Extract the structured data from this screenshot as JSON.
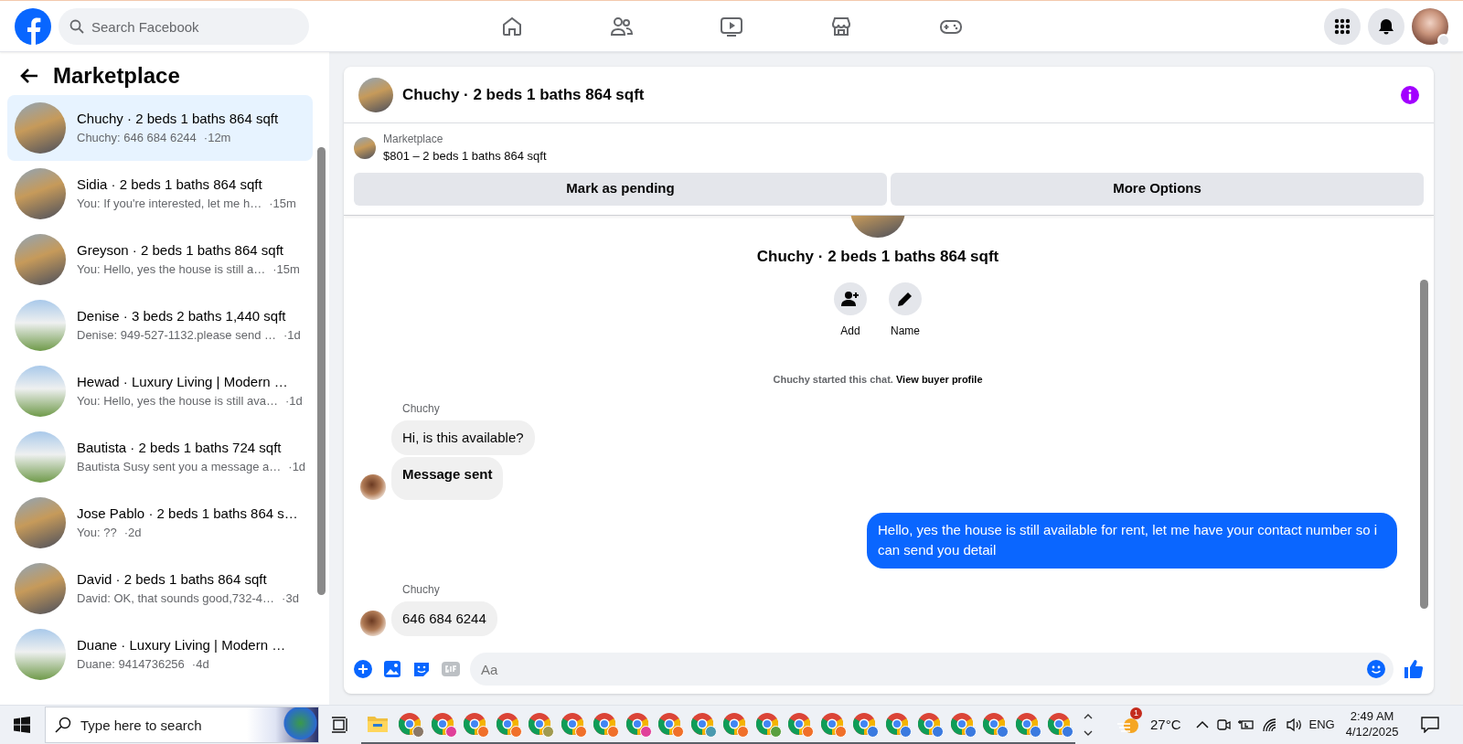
{
  "topbar": {
    "search": {
      "placeholder": "Search Facebook"
    }
  },
  "sidebar": {
    "title": "Marketplace",
    "conversations": [
      {
        "title": "Chuchy · 2 beds 1 baths 864 sqft",
        "preview": "Chuchy: 646 684 6244",
        "time": "·12m",
        "kind": "street",
        "selected": true
      },
      {
        "title": "Sidia · 2 beds 1 baths 864 sqft",
        "preview": "You: If you're interested, let me h…",
        "time": "·15m",
        "kind": "street",
        "selected": false
      },
      {
        "title": "Greyson · 2 beds 1 baths 864 sqft",
        "preview": "You: Hello, yes the house is still a…",
        "time": "·15m",
        "kind": "street",
        "selected": false
      },
      {
        "title": "Denise · 3 beds 2 baths 1,440 sqft",
        "preview": "Denise: 949-527-1132.please send …",
        "time": "·1d",
        "kind": "house",
        "selected": false
      },
      {
        "title": "Hewad · Luxury Living | Modern …",
        "preview": "You: Hello, yes the house is still ava…",
        "time": "·1d",
        "kind": "house",
        "selected": false
      },
      {
        "title": "Bautista · 2 beds 1 baths 724 sqft",
        "preview": "Bautista Susy sent you a message a…",
        "time": "·1d",
        "kind": "house",
        "selected": false
      },
      {
        "title": "Jose Pablo · 2 beds 1 baths 864 s…",
        "preview": "You: ??",
        "time": "·2d",
        "kind": "street",
        "selected": false
      },
      {
        "title": "David · 2 beds 1 baths 864 sqft",
        "preview": "David: OK, that sounds good,732-4…",
        "time": "·3d",
        "kind": "street",
        "selected": false
      },
      {
        "title": "Duane · Luxury Living | Modern …",
        "preview": "Duane: 9414736256",
        "time": "·4d",
        "kind": "house",
        "selected": false
      }
    ]
  },
  "chat": {
    "title": "Chuchy · 2 beds 1 baths 864 sqft",
    "listing": {
      "label": "Marketplace",
      "summary": "$801 – 2 beds 1 baths 864 sqft"
    },
    "buttons": [
      "Mark as pending",
      "More Options"
    ],
    "intro": {
      "title": "Chuchy · 2 beds 1 baths 864 sqft",
      "actions": [
        {
          "kind": "add",
          "label": "Add"
        },
        {
          "kind": "name",
          "label": "Name"
        }
      ]
    },
    "notice": {
      "text": "Chuchy started this chat.",
      "link": "View buyer profile"
    },
    "messages": [
      {
        "kind": "incoming",
        "sender": "Chuchy",
        "bubbles": [
          {
            "text": "Hi, is this available?",
            "bold": false
          },
          {
            "text": "Message sent",
            "bold": true
          }
        ]
      },
      {
        "kind": "outgoing",
        "bubbles": [
          {
            "text": "Hello, yes the house is still available for rent, let me have your contact number so i can send you detail",
            "bold": false
          }
        ]
      },
      {
        "kind": "incoming",
        "sender": "Chuchy",
        "bubbles": [
          {
            "text": "646 684 6244",
            "bold": false
          }
        ]
      }
    ],
    "composer": {
      "placeholder": "Aa"
    }
  },
  "taskbar": {
    "search": {
      "placeholder": "Type here to search"
    },
    "apps": [
      {
        "kind": "folder"
      },
      {
        "kind": "browser",
        "color": "#8a7868"
      },
      {
        "kind": "browser",
        "color": "#e0409a"
      },
      {
        "kind": "browser",
        "color": "#f0702a"
      },
      {
        "kind": "browser",
        "color": "#f0702a"
      },
      {
        "kind": "browser",
        "color": "#a09a50"
      },
      {
        "kind": "browser",
        "color": "#f0702a"
      },
      {
        "kind": "browser",
        "color": "#f0702a"
      },
      {
        "kind": "browser",
        "color": "#e0409a"
      },
      {
        "kind": "browser",
        "color": "#f0702a"
      },
      {
        "kind": "browser",
        "color": "#4a9ab0"
      },
      {
        "kind": "browser",
        "color": "#f0702a"
      },
      {
        "kind": "browser",
        "color": "#5aa040"
      },
      {
        "kind": "browser",
        "color": "#f0702a"
      },
      {
        "kind": "browser",
        "color": "#f0702a"
      },
      {
        "kind": "browser",
        "color": "#3a7ae0"
      },
      {
        "kind": "browser",
        "color": "#3a7ae0"
      },
      {
        "kind": "browser",
        "color": "#3a7ae0"
      },
      {
        "kind": "browser",
        "color": "#3a7ae0"
      },
      {
        "kind": "browser",
        "color": "#3a7ae0"
      },
      {
        "kind": "browser",
        "color": "#3a7ae0"
      },
      {
        "kind": "browser",
        "color": "#3a7ae0"
      }
    ],
    "weather": {
      "badge": "1",
      "temperature": "27°C"
    },
    "language": "ENG",
    "time": "2:49 AM",
    "date": "4/12/2025"
  }
}
